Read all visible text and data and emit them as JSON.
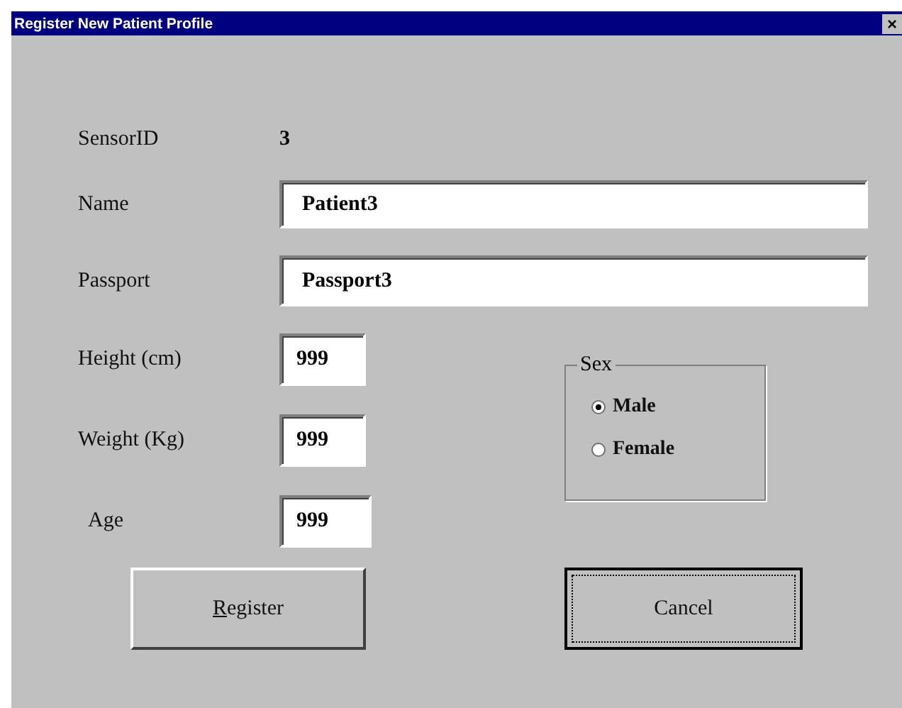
{
  "window": {
    "title": "Register New Patient Profile",
    "close": "×"
  },
  "sensor": {
    "label": "SensorID",
    "value": "3"
  },
  "identity_fields": [
    {
      "label": "Name",
      "value": "Patient3"
    },
    {
      "label": "Passport",
      "value": "Passport3"
    }
  ],
  "measurement_fields": [
    {
      "label": "Height (cm)",
      "value": "999"
    },
    {
      "label": "Weight (Kg)",
      "value": "999"
    },
    {
      "label": "Age",
      "value": "999"
    }
  ],
  "sex_group": {
    "label": "Sex",
    "options": [
      {
        "label": "Male",
        "selected": true
      },
      {
        "label": "Female",
        "selected": false
      }
    ]
  },
  "buttons": [
    {
      "label": "Register",
      "first_letter_underlined": true,
      "focused": false
    },
    {
      "label": "Cancel",
      "first_letter_underlined": false,
      "focused": true
    }
  ]
}
